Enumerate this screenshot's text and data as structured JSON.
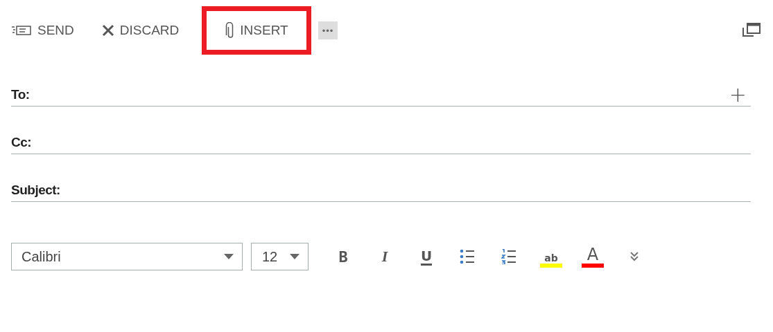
{
  "toolbar": [
    {
      "kind": "send",
      "label": "SEND",
      "highlighted": false
    },
    {
      "kind": "discard",
      "label": "DISCARD",
      "highlighted": false
    },
    {
      "kind": "insert",
      "label": "INSERT",
      "highlighted": true
    },
    {
      "kind": "more",
      "label": "•••",
      "highlighted": false
    }
  ],
  "fields": [
    {
      "label": "To:",
      "add_button": "+"
    },
    {
      "label": "Cc:"
    },
    {
      "label": "Subject:"
    }
  ],
  "format": {
    "font": "Calibri",
    "size": "12",
    "buttons": [
      {
        "kind": "bold",
        "label": "B"
      },
      {
        "kind": "italic",
        "label": "I"
      },
      {
        "kind": "underline",
        "label": "U"
      },
      {
        "kind": "bullets"
      },
      {
        "kind": "numbering"
      },
      {
        "kind": "highlight",
        "label": "ab",
        "color": "#ffff00"
      },
      {
        "kind": "font-color",
        "label": "A",
        "color": "#ff0000"
      },
      {
        "kind": "expand"
      }
    ]
  }
}
